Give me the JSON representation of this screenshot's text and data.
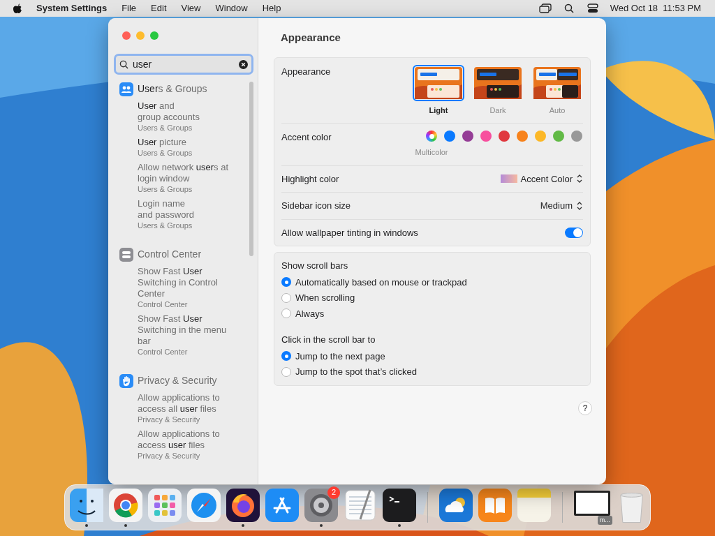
{
  "menubar": {
    "app_name": "System Settings",
    "menus": [
      "File",
      "Edit",
      "View",
      "Window",
      "Help"
    ],
    "clock": "Wed Oct 18  11:53 PM"
  },
  "sidebar": {
    "search": {
      "value": "user"
    },
    "groups": [
      {
        "title": "**User**s & Groups",
        "kind": "users",
        "results": [
          {
            "text": "**User** and\ngroup accounts",
            "section": "Users & Groups"
          },
          {
            "text": "**User** picture",
            "section": "Users & Groups"
          },
          {
            "text": "Allow network **user**s at login window",
            "section": "Users & Groups"
          },
          {
            "text": "Login name\nand password",
            "section": "Users & Groups"
          }
        ]
      },
      {
        "title": "Control Center",
        "kind": "control",
        "results": [
          {
            "text": "Show Fast **User** Switching in Control Center",
            "section": "Control Center"
          },
          {
            "text": "Show Fast **User** Switching in the menu bar",
            "section": "Control Center"
          }
        ]
      },
      {
        "title": "Privacy & Security",
        "kind": "hand",
        "results": [
          {
            "text": "Allow applications to access all **user** files",
            "section": "Privacy & Security"
          },
          {
            "text": "Allow applications to access **user** files",
            "section": "Privacy & Security"
          }
        ]
      }
    ]
  },
  "content": {
    "title": "Appearance",
    "appearance": {
      "label": "Appearance",
      "options": [
        {
          "label": "Light",
          "kind": "light",
          "selected": true
        },
        {
          "label": "Dark",
          "kind": "dark",
          "selected": false
        },
        {
          "label": "Auto",
          "kind": "auto",
          "selected": false
        }
      ]
    },
    "accent": {
      "label": "Accent color",
      "selected_name": "Multicolor",
      "colors": [
        {
          "kind": "multi",
          "selected": true
        },
        {
          "color": "#0a7aff",
          "selected": false
        },
        {
          "color": "#953d96",
          "selected": false
        },
        {
          "color": "#f74f9e",
          "selected": false
        },
        {
          "color": "#e0383e",
          "selected": false
        },
        {
          "color": "#f7821b",
          "selected": false
        },
        {
          "color": "#fcb827",
          "selected": false
        },
        {
          "color": "#62ba46",
          "selected": false
        },
        {
          "color": "#989898",
          "selected": false
        }
      ]
    },
    "highlight": {
      "label": "Highlight color",
      "value": "Accent Color"
    },
    "icon_size": {
      "label": "Sidebar icon size",
      "value": "Medium"
    },
    "tinting": {
      "label": "Allow wallpaper tinting in windows",
      "on": true
    },
    "scroll_bars": {
      "title": "Show scroll bars",
      "options": [
        {
          "label": "Automatically based on mouse or trackpad",
          "selected": true
        },
        {
          "label": "When scrolling",
          "selected": false
        },
        {
          "label": "Always",
          "selected": false
        }
      ]
    },
    "click_scroll": {
      "title": "Click in the scroll bar to",
      "options": [
        {
          "label": "Jump to the next page",
          "selected": true
        },
        {
          "label": "Jump to the spot that’s clicked",
          "selected": false
        }
      ]
    },
    "help": "?"
  },
  "dock": {
    "apps": [
      {
        "kind": "finder",
        "running": true
      },
      {
        "kind": "chrome",
        "running": true
      },
      {
        "kind": "launchpad",
        "running": false
      },
      {
        "kind": "safari",
        "running": false
      },
      {
        "kind": "firefox",
        "running": true
      },
      {
        "kind": "appstore",
        "running": false
      },
      {
        "kind": "settings",
        "running": true,
        "badge": "2"
      },
      {
        "kind": "textedit",
        "running": false
      },
      {
        "kind": "terminal",
        "running": true
      }
    ],
    "extras": [
      {
        "kind": "weather"
      },
      {
        "kind": "books"
      },
      {
        "kind": "notes"
      }
    ],
    "minimized": {
      "label": "m..."
    }
  }
}
